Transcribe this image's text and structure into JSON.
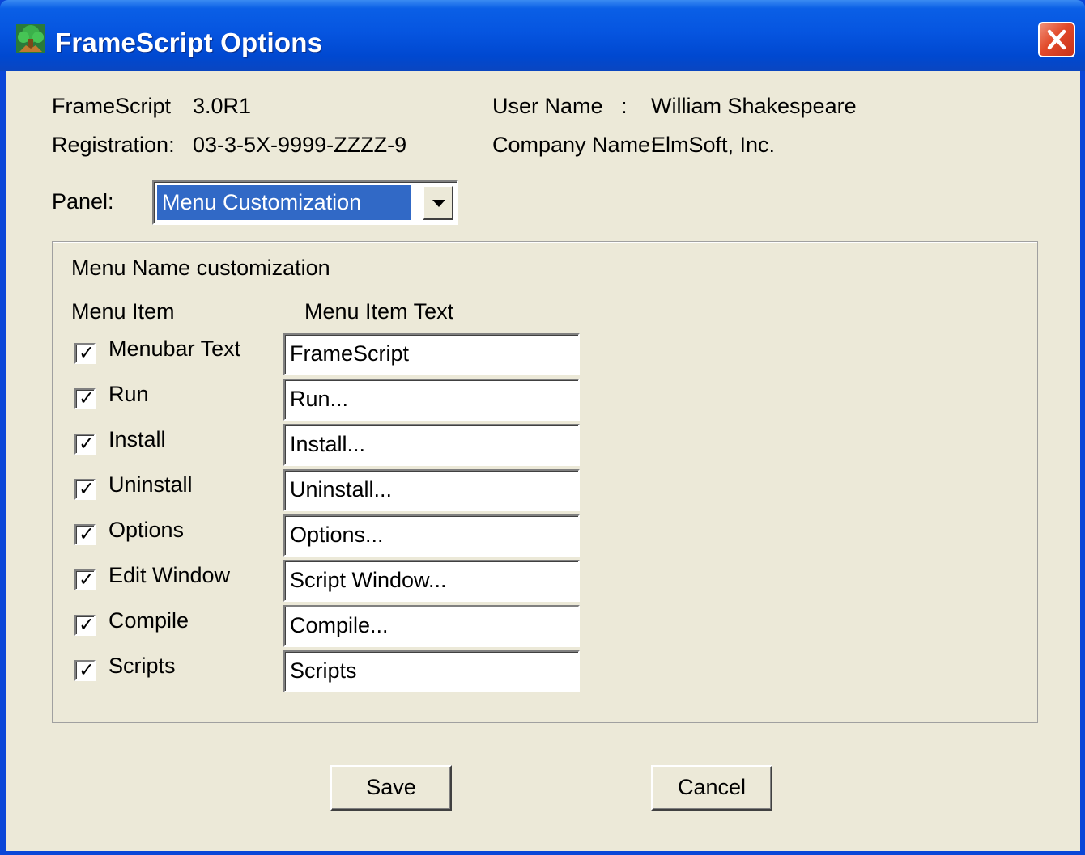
{
  "window": {
    "title": "FrameScript Options",
    "icon": "tree-icon",
    "close_icon": "close-icon"
  },
  "info": {
    "product_label": "FrameScript",
    "product_version": "3.0R1",
    "registration_label": "Registration:",
    "registration_value": "03-3-5X-9999-ZZZZ-9",
    "user_label": "User Name   :",
    "user_value": "William Shakespeare",
    "company_label": "Company Name:",
    "company_value": "ElmSoft, Inc."
  },
  "panel": {
    "label": "Panel:",
    "selected": "Menu Customization"
  },
  "group": {
    "title": "Menu Name customization",
    "col_item": "Menu Item",
    "col_text": "Menu Item Text",
    "rows": [
      {
        "label": "Menubar Text",
        "checked": true,
        "value": "FrameScript"
      },
      {
        "label": "Run",
        "checked": true,
        "value": "Run..."
      },
      {
        "label": "Install",
        "checked": true,
        "value": "Install..."
      },
      {
        "label": "Uninstall",
        "checked": true,
        "value": "Uninstall..."
      },
      {
        "label": "Options",
        "checked": true,
        "value": "Options..."
      },
      {
        "label": "Edit Window",
        "checked": true,
        "value": "Script Window..."
      },
      {
        "label": "Compile",
        "checked": true,
        "value": "Compile..."
      },
      {
        "label": "Scripts",
        "checked": true,
        "value": "Scripts"
      }
    ]
  },
  "buttons": {
    "save": "Save",
    "cancel": "Cancel"
  },
  "colors": {
    "title_bar": "#0655e0",
    "dialog_bg": "#ece9d8",
    "selection": "#3169c6",
    "close_button": "#e24a2a"
  }
}
